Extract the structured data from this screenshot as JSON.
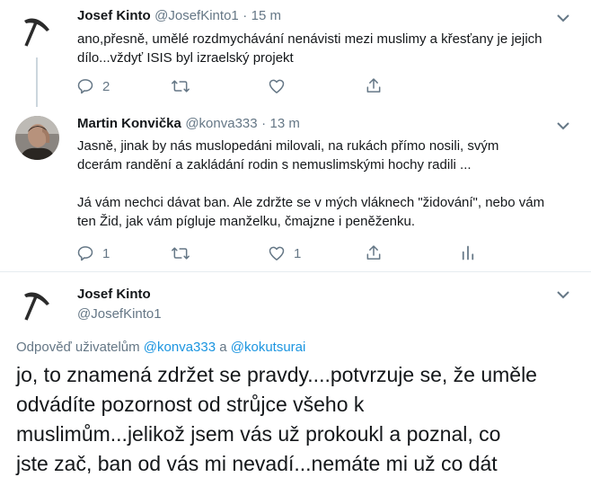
{
  "tweet1": {
    "name": "Josef Kinto",
    "handle": "@JosefKinto1",
    "time": "15 m",
    "separator": "·",
    "text_lines": [
      "ano,přesně, umělé rozdmychávání nenávisti mezi muslimy a křesťany je jejich",
      "dílo...vždyť ISIS byl izraelský projekt"
    ],
    "reply_count": "2",
    "icons": [
      "pickaxe-avatar",
      "chevron-down-icon",
      "reply-icon",
      "retweet-icon",
      "heart-icon",
      "share-icon"
    ]
  },
  "tweet2": {
    "name": "Martin Konvička",
    "handle": "@konva333",
    "time": "13 m",
    "separator": "·",
    "paragraph1_lines": [
      "Jasně, jinak by nás muslopedáni milovali, na rukách přímo nosili, svým",
      "dcerám randění a zakládání rodin s nemuslimskými hochy radili ..."
    ],
    "paragraph2_lines": [
      "Já vám nechci dávat ban. Ale zdržte se v mých vláknech \"židování\", nebo vám",
      "ten Žid, jak vám pígluje manželku, čmajzne i peněženku."
    ],
    "reply_count": "1",
    "like_count": "1",
    "icons": [
      "photo-avatar",
      "chevron-down-icon",
      "reply-icon",
      "retweet-icon",
      "heart-icon",
      "share-icon",
      "analytics-icon"
    ]
  },
  "tweet3": {
    "name": "Josef Kinto",
    "handle": "@JosefKinto1",
    "reply_prefix": "Odpověď uživatelům",
    "reply_user1": "@konva333",
    "reply_and": "a",
    "reply_user2": "@kokutsurai",
    "text_lines": [
      "jo, to znamená zdržet se pravdy....potvrzuje se, že uměle",
      "odvádíte pozornost od strůjce všeho k",
      "muslimům...jelikož jsem vás už prokoukl a poznal, co",
      "jste zač, ban od vás mi nevadí...nemáte mi už co dát"
    ]
  },
  "colors": {
    "text": "#14171a",
    "secondary": "#657786",
    "link": "#1b95e0",
    "divider": "#e6ecf0"
  }
}
